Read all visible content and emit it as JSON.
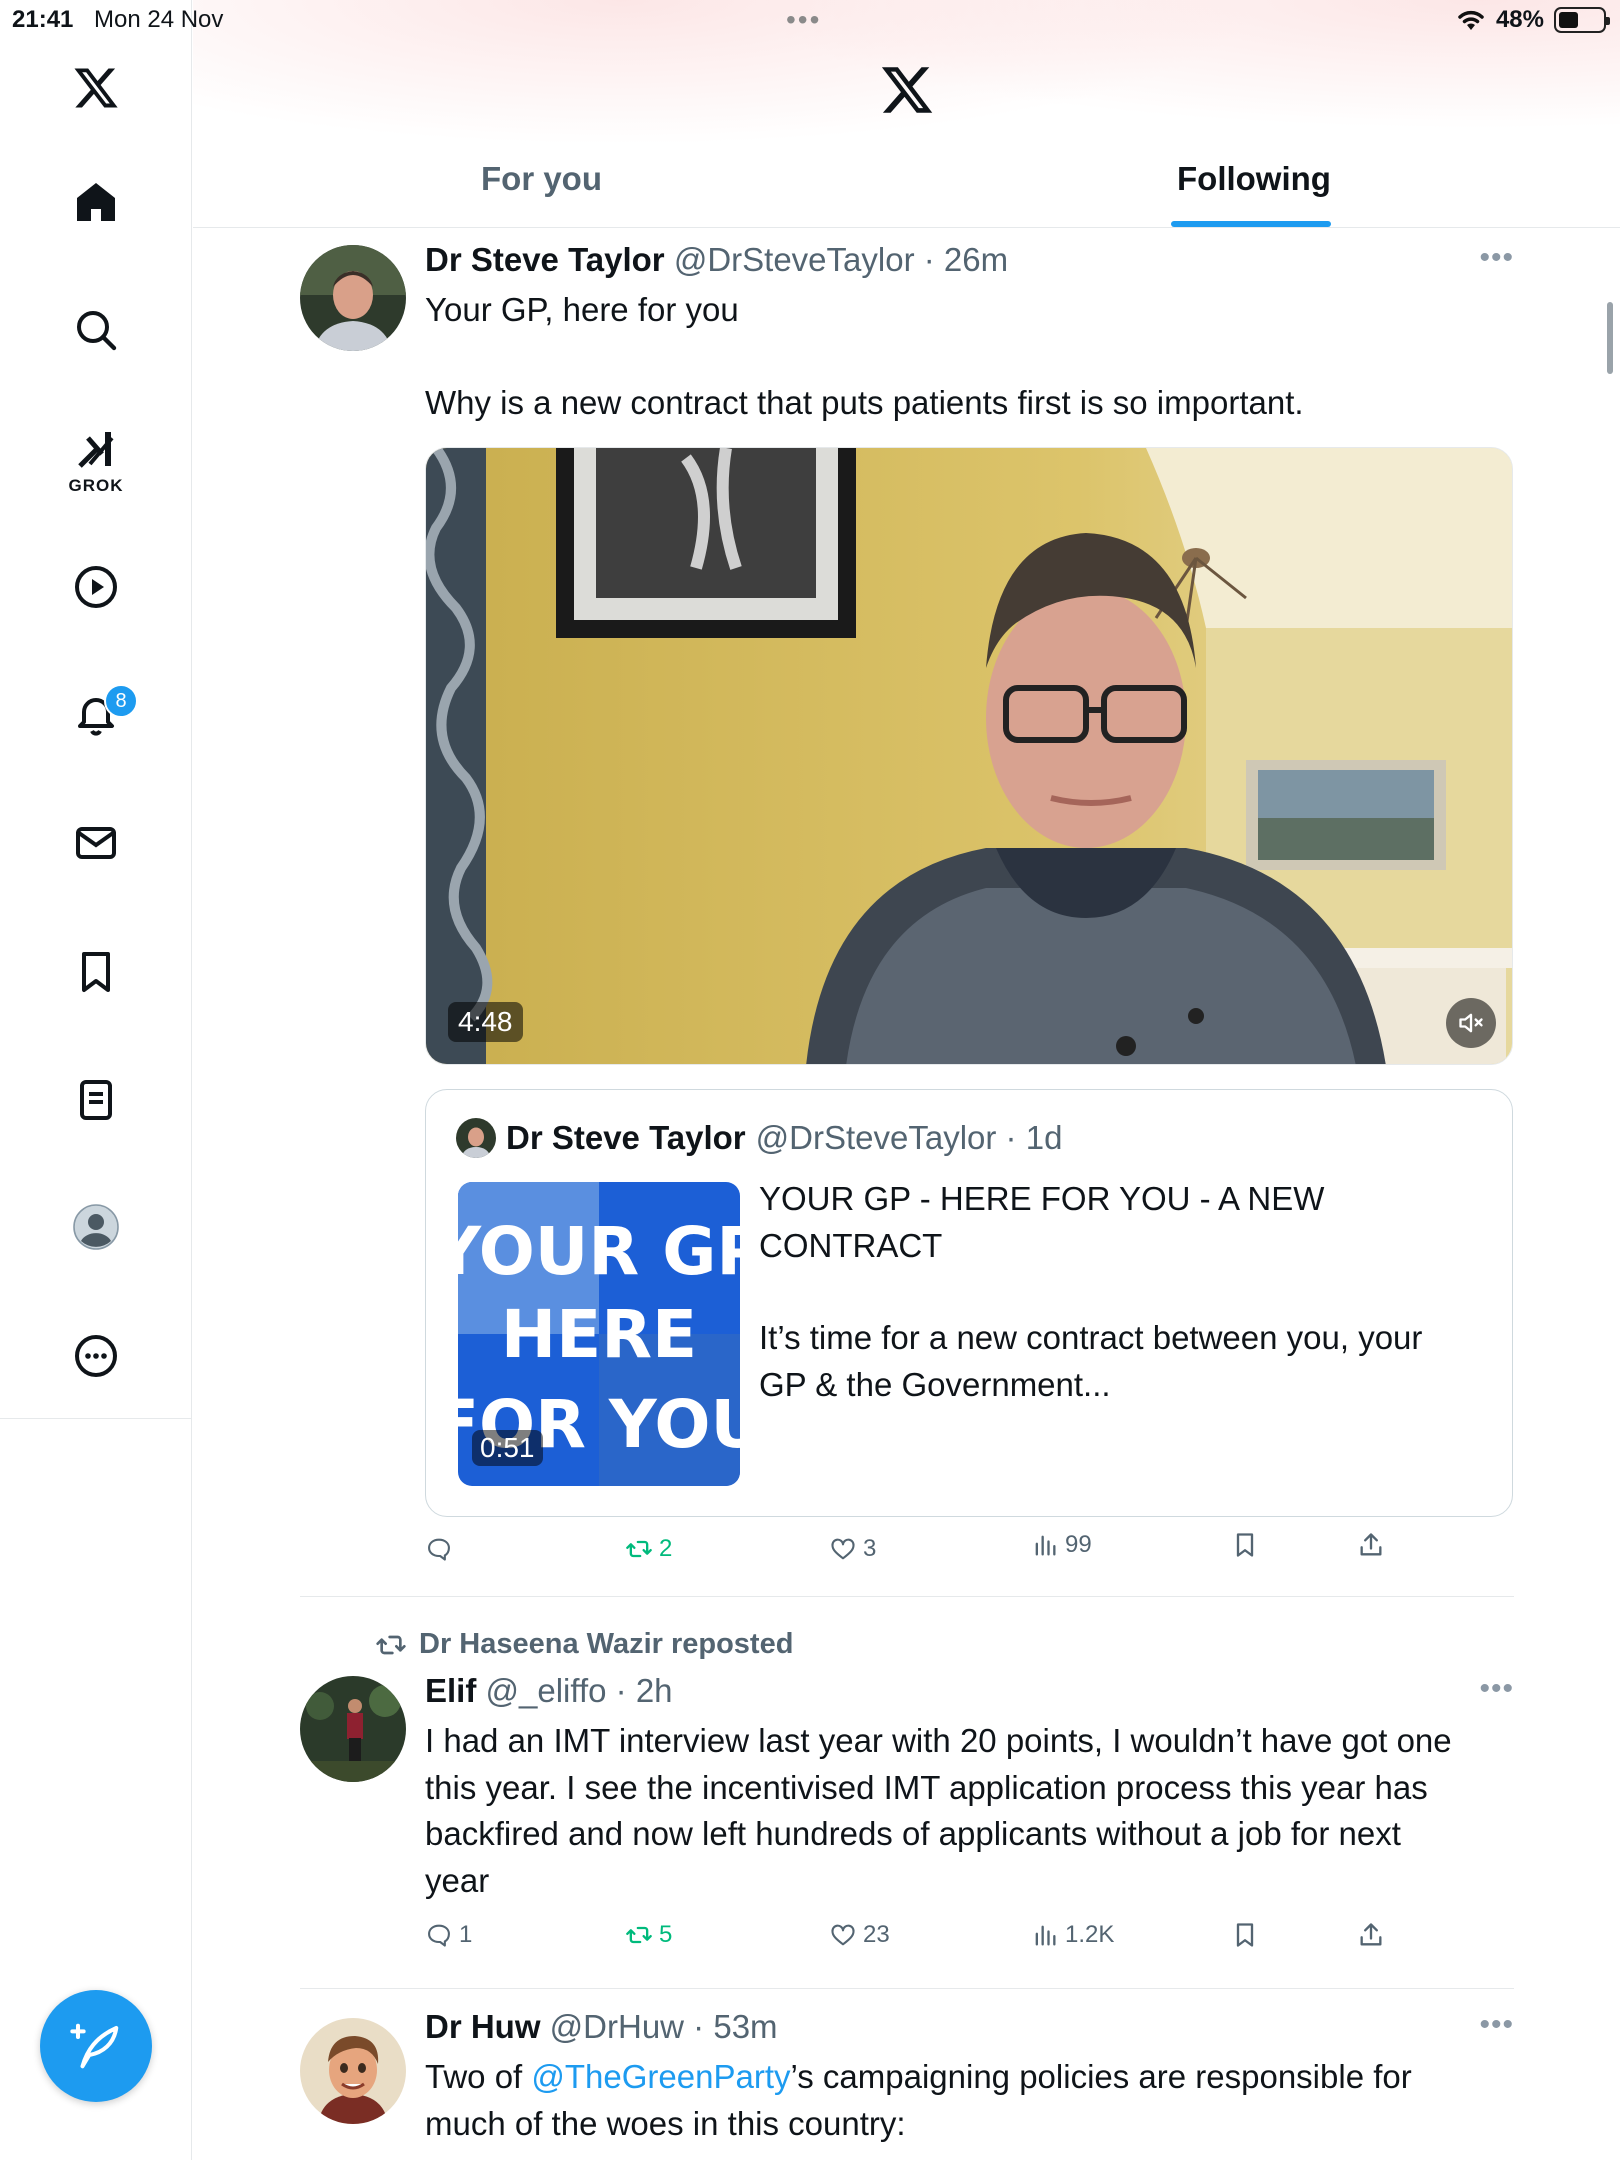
{
  "status_bar": {
    "time": "21:41",
    "date": "Mon 24 Nov",
    "battery": "48%"
  },
  "sidebar": {
    "grok_label": "GROK",
    "notification_count": "8"
  },
  "header": {
    "tabs": [
      {
        "label": "For you",
        "active": false
      },
      {
        "label": "Following",
        "active": true
      }
    ]
  },
  "posts": [
    {
      "name": "Dr Steve Taylor",
      "handle": "@DrSteveTaylor",
      "time": "26m",
      "text_line1": "Your GP, here for you",
      "text_line2": "Why is a new contract that puts patients first is so important.",
      "video_duration": "4:48",
      "quote": {
        "name": "Dr Steve Taylor",
        "handle": "@DrSteveTaylor",
        "time": "1d",
        "title_line1": "YOUR GP - HERE FOR YOU - A NEW",
        "title_line2": "CONTRACT",
        "body_line1": "It’s time for a new contract between you, your",
        "body_line2": "GP & the Government...",
        "thumb_text": [
          "YOUR GP",
          "HERE",
          "FOR YOU"
        ],
        "thumb_duration": "0:51"
      },
      "stats": {
        "replies": "",
        "reposts": "2",
        "likes": "3",
        "views": "99"
      }
    },
    {
      "reposted_by": "Dr Haseena Wazir reposted",
      "name": "Elif",
      "handle": "@_eliffo",
      "time": "2h",
      "lines": [
        "I had an IMT interview last year with 20 points, I wouldn’t have got one",
        "this year. I see the incentivised IMT application process this year has",
        "backfired and now left hundreds of applicants without a job for next",
        "year"
      ],
      "stats": {
        "replies": "1",
        "reposts": "5",
        "likes": "23",
        "views": "1.2K"
      }
    },
    {
      "name": "Dr Huw",
      "handle": "@DrHuw",
      "time": "53m",
      "line1_pre": "Two of ",
      "line1_link": "@TheGreenParty",
      "line1_post": "’s campaigning policies are responsible for",
      "line2": "much of the woes in this country:"
    }
  ],
  "colors": {
    "accent": "#1d9bf0",
    "repost_green": "#00ba7c",
    "muted": "#536471"
  }
}
